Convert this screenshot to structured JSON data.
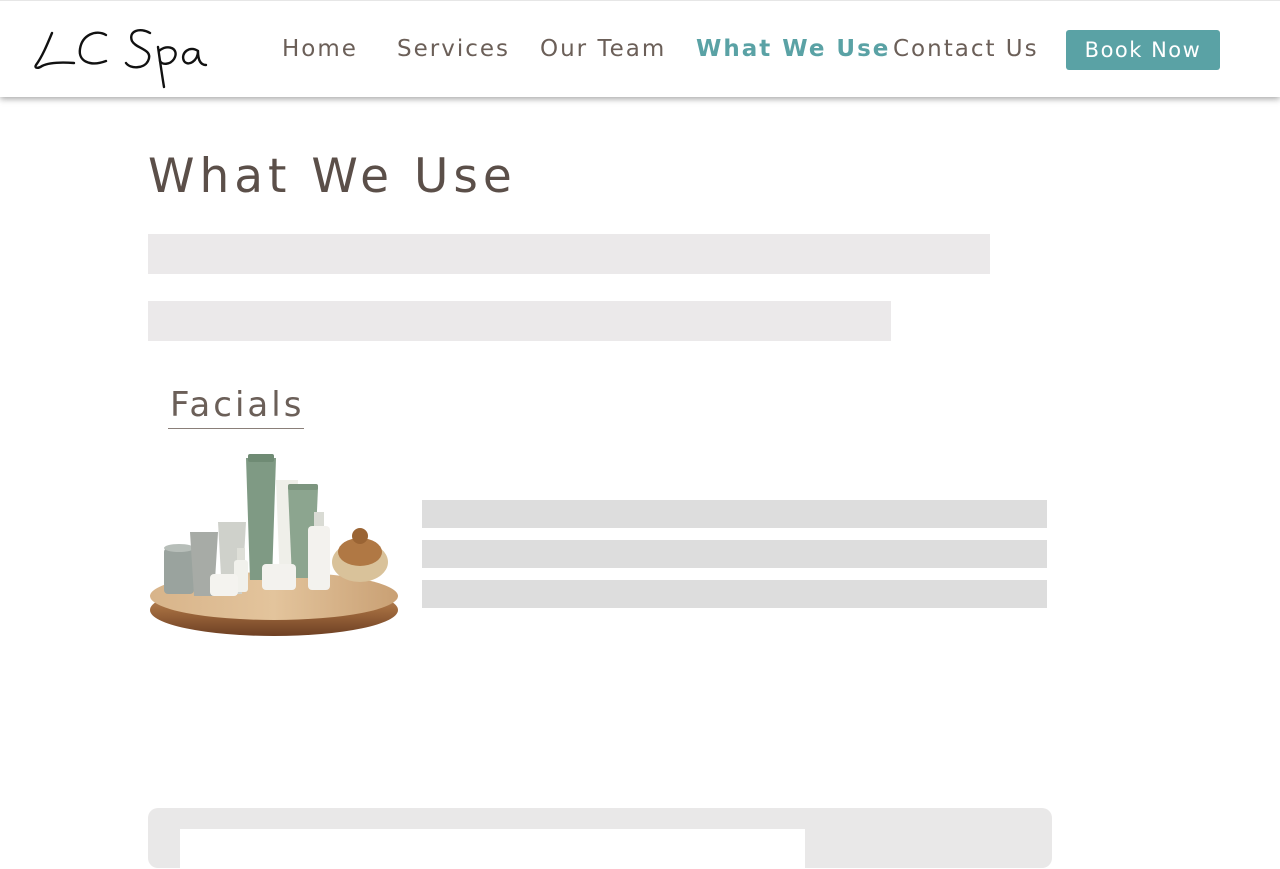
{
  "brand": {
    "logo_text": "LC Spa"
  },
  "nav": {
    "items": [
      {
        "label": "Home"
      },
      {
        "label": "Services"
      },
      {
        "label": "Our Team"
      },
      {
        "label": "What We Use"
      },
      {
        "label": "Contact Us"
      }
    ],
    "book_label": "Book Now"
  },
  "main": {
    "title": "What We Use",
    "sections": [
      {
        "title": "Facials"
      }
    ]
  },
  "colors": {
    "accent": "#5aa2a5",
    "text": "#6b5f58",
    "heading": "#5b4f49",
    "placeholder": "#ebe9ea"
  }
}
